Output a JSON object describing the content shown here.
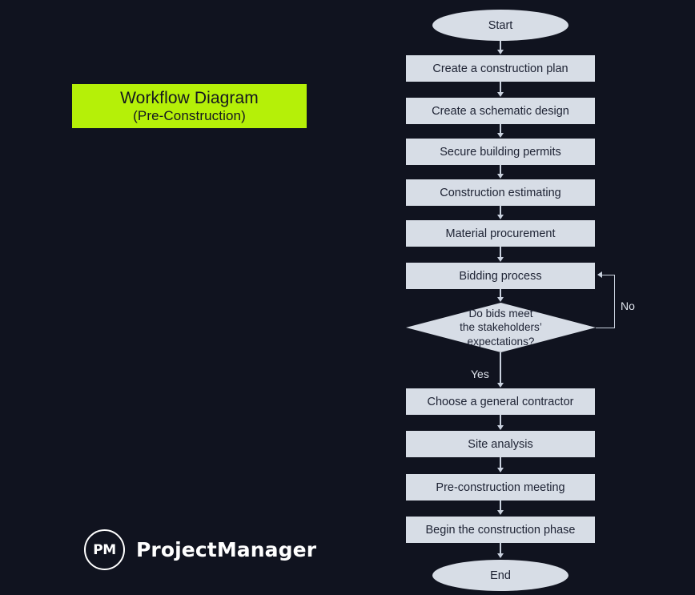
{
  "background_color": "#10131f",
  "title": {
    "line1": "Workflow Diagram",
    "line2": "(Pre-Construction)",
    "background_color": "#b5f008",
    "text_color": "#14161f"
  },
  "logo": {
    "mark_text": "PM",
    "wordmark": "ProjectManager",
    "color": "#ffffff"
  },
  "flowchart": {
    "node_fill": "#d7dde6",
    "node_text_color": "#1d2233",
    "connector_color": "#c9d1de",
    "nodes": [
      {
        "id": "start",
        "shape": "terminator",
        "label": "Start"
      },
      {
        "id": "plan",
        "shape": "process",
        "label": "Create a construction plan"
      },
      {
        "id": "schematic",
        "shape": "process",
        "label": "Create a schematic design"
      },
      {
        "id": "permits",
        "shape": "process",
        "label": "Secure building permits"
      },
      {
        "id": "estimating",
        "shape": "process",
        "label": "Construction estimating"
      },
      {
        "id": "material",
        "shape": "process",
        "label": "Material procurement"
      },
      {
        "id": "bidding",
        "shape": "process",
        "label": "Bidding process"
      },
      {
        "id": "decision",
        "shape": "decision",
        "label": "Do bids meet\nthe stakeholders’\nexpectations?"
      },
      {
        "id": "contractor",
        "shape": "process",
        "label": "Choose a general contractor"
      },
      {
        "id": "site",
        "shape": "process",
        "label": "Site analysis"
      },
      {
        "id": "meeting",
        "shape": "process",
        "label": "Pre-construction meeting"
      },
      {
        "id": "begin",
        "shape": "process",
        "label": "Begin the construction phase"
      },
      {
        "id": "end",
        "shape": "terminator",
        "label": "End"
      }
    ],
    "edge_labels": {
      "yes": "Yes",
      "no": "No"
    }
  }
}
